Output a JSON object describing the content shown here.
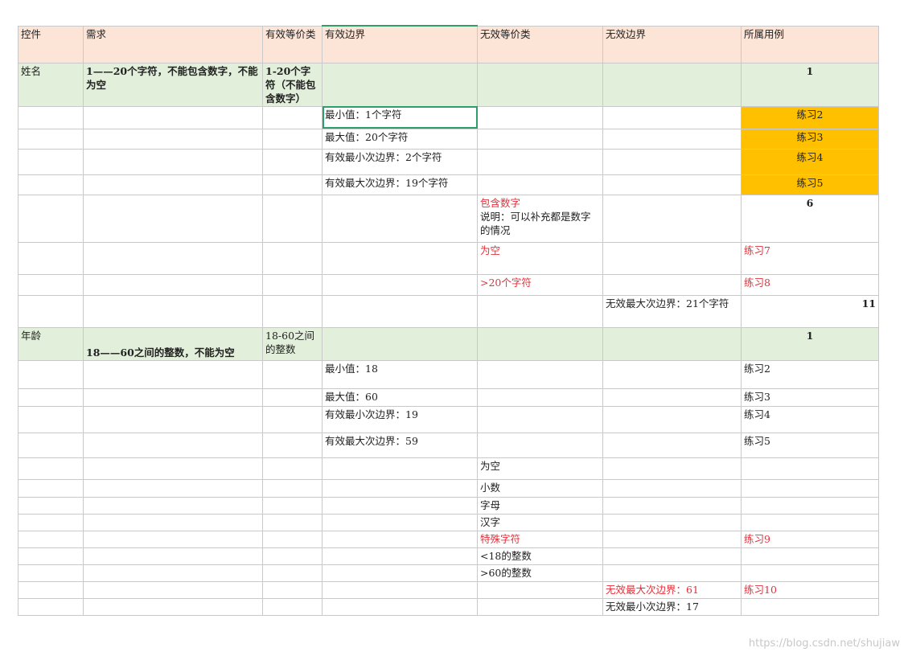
{
  "headers": [
    "控件",
    "需求",
    "有效等价类",
    "有效边界",
    "无效等价类",
    "无效边界",
    "所属用例"
  ],
  "rows": [
    {
      "h": 47,
      "cls": "group",
      "cells": [
        "姓名",
        "1——20个字符，不能包含数字，不能为空",
        "1-20个字符（不能包含数字）",
        "",
        "",
        "",
        "1"
      ]
    },
    {
      "h": 28,
      "cells": [
        "",
        "",
        "",
        "最小值：1个字符",
        "",
        "",
        "练习2"
      ]
    },
    {
      "h": 25,
      "cells": [
        "",
        "",
        "",
        "最大值：20个字符",
        "",
        "",
        "练习3"
      ]
    },
    {
      "h": 32,
      "cells": [
        "",
        "",
        "",
        "有效最小次边界：2个字符",
        "",
        "",
        "练习4"
      ]
    },
    {
      "h": 25,
      "cells": [
        "",
        "",
        "",
        "有效最大次边界：19个字符",
        "",
        "",
        "练习5"
      ]
    },
    {
      "h": 59,
      "cells": [
        "",
        "",
        "",
        "",
        "包含数字\n说明：可以补充都是数字的情况",
        "",
        "6"
      ]
    },
    {
      "h": 40,
      "cells": [
        "",
        "",
        "",
        "",
        "为空",
        "",
        "练习7"
      ]
    },
    {
      "h": 26,
      "cells": [
        "",
        "",
        "",
        "",
        ">20个字符",
        "",
        "练习8"
      ]
    },
    {
      "h": 40,
      "cells": [
        "",
        "",
        "",
        "",
        "",
        "无效最大次边界：21个字符",
        "11"
      ]
    },
    {
      "h": 41,
      "cls": "group",
      "cells": [
        "年龄",
        "18——60之间的整数，不能为空",
        "18-60之间的整数",
        "",
        "",
        "",
        "1"
      ]
    },
    {
      "h": 35,
      "cells": [
        "",
        "",
        "",
        "最小值：18",
        "",
        "",
        "练习2"
      ]
    },
    {
      "h": 22,
      "cells": [
        "",
        "",
        "",
        "最大值：60",
        "",
        "",
        "练习3"
      ]
    },
    {
      "h": 33,
      "cells": [
        "",
        "",
        "",
        "有效最小次边界：19",
        "",
        "",
        "练习4"
      ]
    },
    {
      "h": 31,
      "cells": [
        "",
        "",
        "",
        "有效最大次边界：59",
        "",
        "",
        "练习5"
      ]
    },
    {
      "h": 27,
      "cells": [
        "",
        "",
        "",
        "",
        "为空",
        "",
        ""
      ]
    },
    {
      "h": 22,
      "cells": [
        "",
        "",
        "",
        "",
        "小数",
        "",
        ""
      ]
    },
    {
      "h": 21,
      "cells": [
        "",
        "",
        "",
        "",
        "字母",
        "",
        ""
      ]
    },
    {
      "h": 21,
      "cells": [
        "",
        "",
        "",
        "",
        "汉字",
        "",
        ""
      ]
    },
    {
      "h": 21,
      "cells": [
        "",
        "",
        "",
        "",
        "特殊字符",
        "",
        "练习9"
      ]
    },
    {
      "h": 21,
      "cells": [
        "",
        "",
        "",
        "",
        "<18的整数",
        "",
        ""
      ]
    },
    {
      "h": 21,
      "cells": [
        "",
        "",
        "",
        "",
        ">60的整数",
        "",
        ""
      ]
    },
    {
      "h": 21,
      "cells": [
        "",
        "",
        "",
        "",
        "",
        "无效最大次边界：61",
        "练习10"
      ]
    },
    {
      "h": 21,
      "cells": [
        "",
        "",
        "",
        "",
        "",
        "无效最小次边界：17",
        ""
      ]
    }
  ],
  "watermark": "https://blog.csdn.net/shujiaw",
  "colors": {
    "header_fill": "#fce4d6",
    "group_fill": "#e2efda",
    "highlight_fill": "#ffc000",
    "red_text": "#e5303a",
    "selection": "#2e9e6b"
  }
}
